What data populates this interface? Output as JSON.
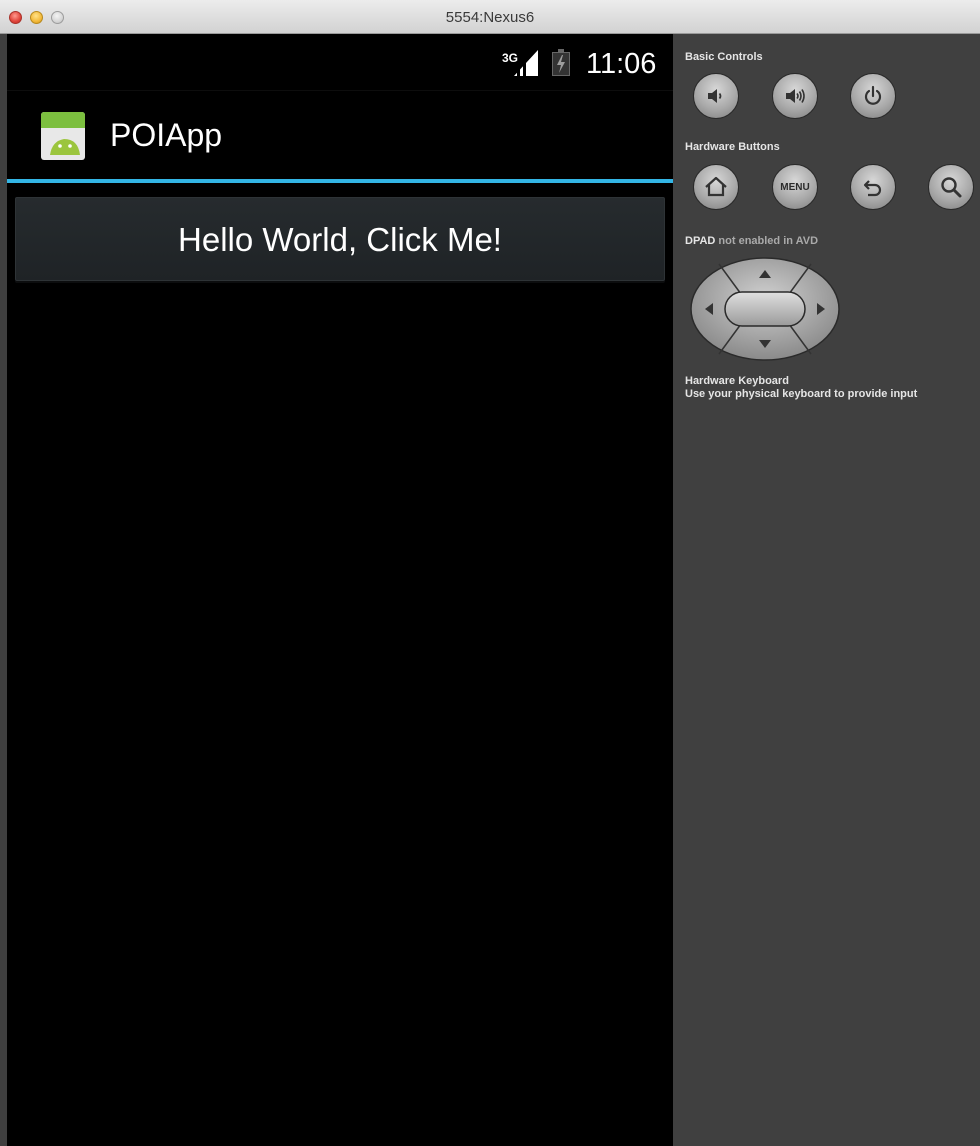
{
  "window": {
    "title": "5554:Nexus6"
  },
  "status_bar": {
    "network": "3G",
    "time": "11:06"
  },
  "app": {
    "title": "POIApp",
    "button_label": "Hello World, Click Me!"
  },
  "panel": {
    "basic_controls": {
      "label": "Basic Controls",
      "buttons": [
        "volume-down-icon",
        "volume-up-icon",
        "power-icon"
      ]
    },
    "hardware_buttons": {
      "label": "Hardware Buttons",
      "menu_label": "MENU",
      "buttons": [
        "home-icon",
        "menu",
        "back-icon",
        "search-icon"
      ]
    },
    "dpad": {
      "label_bold": "DPAD",
      "label_rest": "not enabled in AVD"
    },
    "keyboard": {
      "title": "Hardware Keyboard",
      "description": "Use your physical keyboard to provide input"
    }
  },
  "colors": {
    "accent": "#33b5e5",
    "panel_bg": "#404040",
    "screen_bg": "#000000"
  }
}
